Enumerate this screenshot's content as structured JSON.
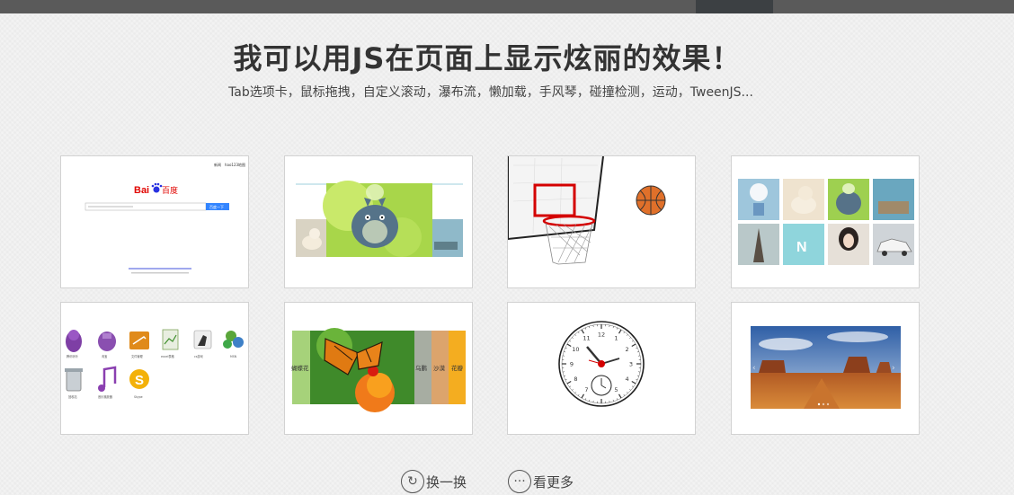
{
  "header": {
    "title": "我可以用JS在页面上显示炫丽的效果！",
    "subtitle": "Tab选项卡，鼠标拖拽，自定义滚动，瀑布流，懒加载，手风琴，碰撞检测，运动，TweenJS..."
  },
  "cards": {
    "baidu": {
      "logo_bai": "Bai",
      "logo_du": "百度",
      "nav_links": [
        "新闻",
        "hao123",
        "地图"
      ],
      "search_button": "百度一下"
    },
    "accordion": {
      "labels": [
        "蝴蝶花",
        "乌鹏",
        "沙漠",
        "花瓣"
      ]
    },
    "desktop": {
      "icon_labels": [
        "腾讯听听",
        "淘宝",
        "文件管理",
        "excel表格",
        "cs游戏",
        "MSN",
        "回收站",
        "音乐播放器",
        "Skype"
      ]
    }
  },
  "actions": {
    "refresh_label": "换一换",
    "more_label": "看更多"
  },
  "icons": {
    "refresh": "refresh-icon",
    "more": "ellipsis-icon"
  },
  "colors": {
    "topbar": "#5a5a5a",
    "baidu_red": "#e10602",
    "baidu_blue": "#2932e1",
    "hoop_red": "#d40000",
    "ball_orange": "#e0702a"
  }
}
